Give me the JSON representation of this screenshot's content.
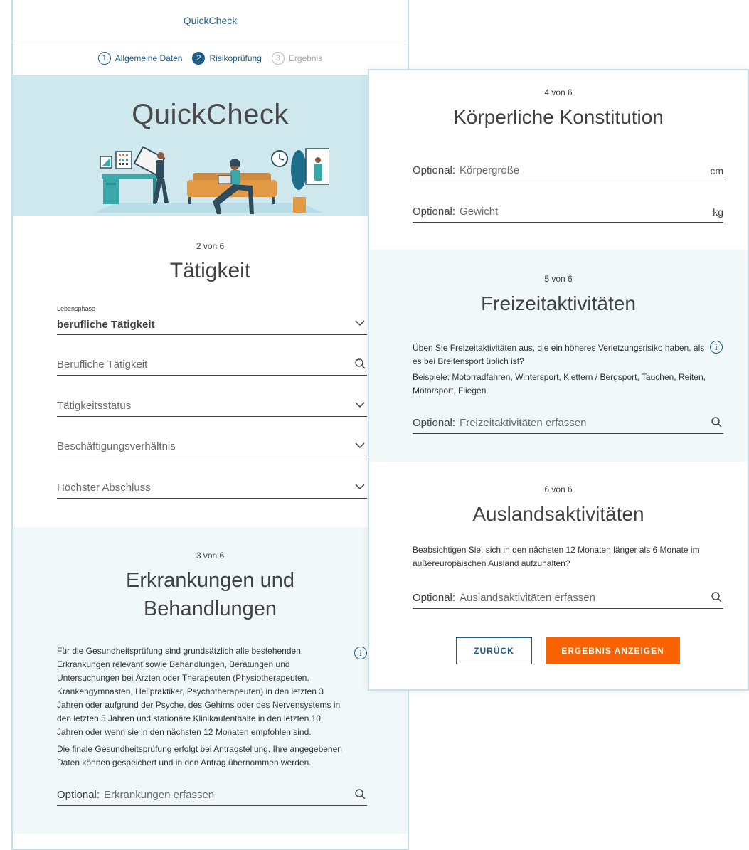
{
  "header": {
    "title": "QuickCheck"
  },
  "stepper": [
    {
      "num": "1",
      "label": "Allgemeine Daten",
      "state": "done"
    },
    {
      "num": "2",
      "label": "Risikoprüfung",
      "state": "active"
    },
    {
      "num": "3",
      "label": "Ergebnis",
      "state": "todo"
    }
  ],
  "hero": {
    "title": "QuickCheck"
  },
  "section2": {
    "counter": "2 von 6",
    "title": "Tätigkeit",
    "lebensphase_label": "Lebensphase",
    "lebensphase_value": "berufliche Tätigkeit",
    "berufliche_taetigkeit": "Berufliche Tätigkeit",
    "taetigkeitsstatus": "Tätigkeitsstatus",
    "beschaeftigungsverhaeltnis": "Beschäftigungsverhältnis",
    "hoechster_abschluss": "Höchster Abschluss"
  },
  "section3": {
    "counter": "3 von 6",
    "title_line1": "Erkrankungen und",
    "title_line2": "Behandlungen",
    "paragraph1": "Für die Gesundheitsprüfung sind grundsätzlich alle bestehenden Erkrankungen relevant sowie Behandlungen, Beratungen und Untersuchungen bei Ärzten oder Therapeuten (Physiotherapeuten, Krankengymnasten, Heilpraktiker, Psychotherapeuten) in den letzten 3 Jahren oder aufgrund der Psyche, des Gehirns oder des Nervensystems in den letzten 5 Jahren und stationäre Klinikaufenthalte in den letzten 10 Jahren oder wenn sie in den nächsten 12 Monaten empfohlen sind.",
    "paragraph2": "Die finale Gesundheitsprüfung erfolgt bei Antragstellung. Ihre angegebenen Daten können gespeichert und in den Antrag übernommen werden.",
    "optional": "Optional:",
    "field_label": "Erkrankungen erfassen"
  },
  "section4": {
    "counter": "4 von 6",
    "title": "Körperliche Konstitution",
    "optional": "Optional:",
    "height_label": "Körpergroße",
    "height_unit": "cm",
    "weight_label": "Gewicht",
    "weight_unit": "kg"
  },
  "section5": {
    "counter": "5 von 6",
    "title": "Freizeitaktivitäten",
    "question": "Üben Sie Freizeitaktivitäten aus, die ein höheres Verletzungsrisiko haben, als es bei Breitensport üblich ist?",
    "examples": "Beispiele: Motorradfahren, Wintersport, Klettern / Bergsport, Tauchen, Reiten, Motorsport, Fliegen.",
    "optional": "Optional:",
    "field_label": "Freizeitaktivitäten erfassen"
  },
  "section6": {
    "counter": "6 von 6",
    "title": "Auslandsaktivitäten",
    "question": "Beabsichtigen Sie, sich in den nächsten 12 Monaten länger als 6 Monate im außereuropäischen Ausland aufzuhalten?",
    "optional": "Optional:",
    "field_label": "Auslandsaktivitäten erfassen"
  },
  "buttons": {
    "back": "ZURÜCK",
    "result": "ERGEBNIS ANZEIGEN"
  },
  "info_glyph": "i",
  "colors": {
    "brand_blue": "#1c5f8a",
    "hero_bg": "#cfe8ee",
    "light_section": "#f1f8fa",
    "accent_orange": "#f86200"
  }
}
